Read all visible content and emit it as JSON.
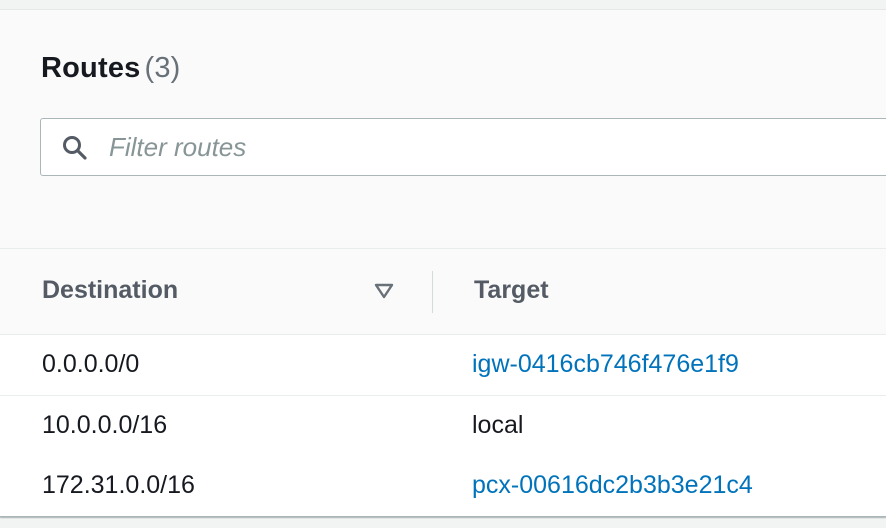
{
  "routes_panel": {
    "title": "Routes",
    "count": "(3)"
  },
  "filter": {
    "placeholder": "Filter routes",
    "value": "",
    "icon": "search-icon"
  },
  "table": {
    "columns": {
      "destination": "Destination",
      "target": "Target"
    },
    "sort_icon": "sort-down-triangle-icon",
    "rows": [
      {
        "destination": "0.0.0.0/0",
        "target": "igw-0416cb746f476e1f9",
        "target_is_link": true
      },
      {
        "destination": "10.0.0.0/16",
        "target": "local",
        "target_is_link": false
      },
      {
        "destination": "172.31.0.0/16",
        "target": "pcx-00616dc2b3b3e21c4",
        "target_is_link": true
      }
    ]
  },
  "colors": {
    "link": "#0073bb",
    "text": "#16191f",
    "muted": "#687078",
    "header_text": "#545b64",
    "border": "#aab7b8"
  }
}
